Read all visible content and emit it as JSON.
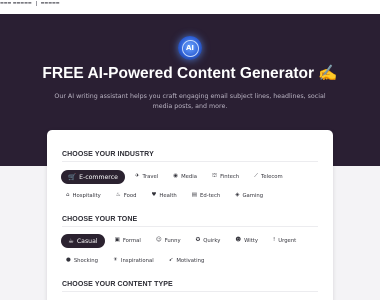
{
  "colors": {
    "hero_bg": "#2a1f33",
    "card_bg": "#ffffff",
    "active_chip_bg": "#2b2230",
    "badge_blue": "#2d5fd6"
  },
  "hero": {
    "badge_icon": "ai-brain-icon",
    "badge_text": "AI",
    "title": "FREE AI-Powered Content Generator ✍️",
    "subtitle": "Our AI writing assistant helps you craft engaging email subject lines, headlines, social media posts, and more."
  },
  "industry": {
    "title": "CHOOSE YOUR INDUSTRY",
    "rows": [
      [
        {
          "label": "E-commerce",
          "icon": "cart-icon",
          "glyph": "🛒",
          "active": true
        },
        {
          "label": "Travel",
          "icon": "plane-icon",
          "glyph": "✈",
          "active": false
        },
        {
          "label": "Media",
          "icon": "media-icon",
          "glyph": "◉",
          "active": false
        },
        {
          "label": "Fintech",
          "icon": "bank-icon",
          "glyph": "⛫",
          "active": false
        },
        {
          "label": "Telecom",
          "icon": "signal-icon",
          "glyph": "⟋",
          "active": false
        }
      ],
      [
        {
          "label": "Hospitality",
          "icon": "hotel-icon",
          "glyph": "⌂",
          "active": false
        },
        {
          "label": "Food",
          "icon": "food-icon",
          "glyph": "♨",
          "active": false
        },
        {
          "label": "Health",
          "icon": "heart-icon",
          "glyph": "♥",
          "active": false
        },
        {
          "label": "Ed-tech",
          "icon": "book-icon",
          "glyph": "▤",
          "active": false
        },
        {
          "label": "Gaming",
          "icon": "gamepad-icon",
          "glyph": "◈",
          "active": false
        }
      ]
    ]
  },
  "tone": {
    "title": "CHOOSE YOUR TONE",
    "rows": [
      [
        {
          "label": "Casual",
          "icon": "casual-icon",
          "glyph": "☕",
          "active": true
        },
        {
          "label": "Formal",
          "icon": "briefcase-icon",
          "glyph": "▣",
          "active": false
        },
        {
          "label": "Funny",
          "icon": "laugh-icon",
          "glyph": "☺",
          "active": false
        },
        {
          "label": "Quirky",
          "icon": "quirky-icon",
          "glyph": "✪",
          "active": false
        },
        {
          "label": "Witty",
          "icon": "witty-icon",
          "glyph": "☻",
          "active": false
        },
        {
          "label": "Urgent",
          "icon": "alert-icon",
          "glyph": "!",
          "active": false
        }
      ],
      [
        {
          "label": "Shocking",
          "icon": "shock-icon",
          "glyph": "●",
          "active": false
        },
        {
          "label": "Inspirational",
          "icon": "inspire-icon",
          "glyph": "☀",
          "active": false
        },
        {
          "label": "Motivating",
          "icon": "rocket-icon",
          "glyph": "➹",
          "active": false
        }
      ]
    ]
  },
  "content_type": {
    "title": "CHOOSE YOUR CONTENT TYPE"
  }
}
